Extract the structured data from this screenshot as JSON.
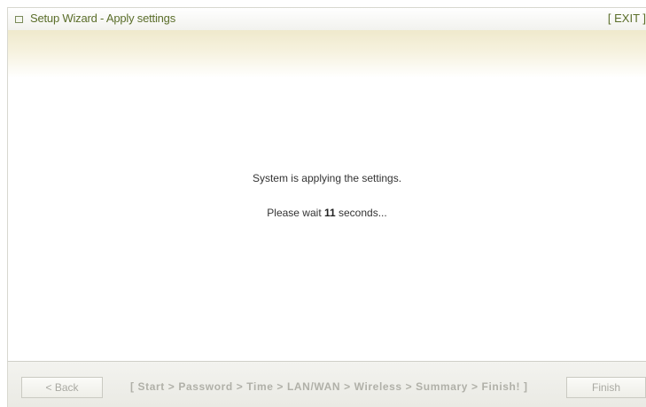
{
  "window": {
    "title": "Setup Wizard - Apply settings",
    "exit_label": "[ EXIT ]"
  },
  "message": {
    "line1": "System is applying the settings.",
    "wait_prefix": "Please wait ",
    "seconds_remaining": "11",
    "wait_suffix": " seconds..."
  },
  "footer": {
    "back_label": "< Back",
    "finish_label": "Finish",
    "steps_text": "[ Start > Password > Time > LAN/WAN > Wireless > Summary > Finish! ]"
  },
  "colors": {
    "title_text": "#5b6e2a",
    "header_shade": "#efe9cc",
    "disabled_text": "#a9a9a2"
  },
  "icons": {
    "title_icon": "window-square-icon"
  }
}
